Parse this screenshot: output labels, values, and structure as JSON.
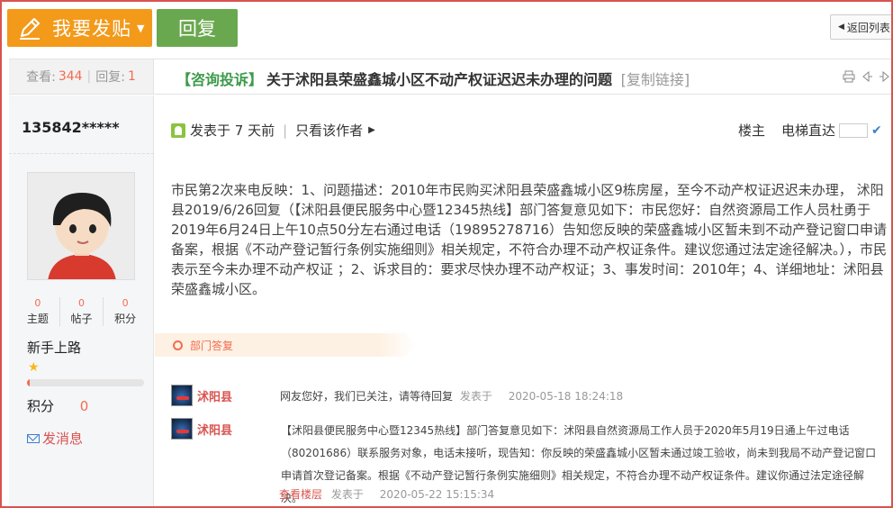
{
  "toolbar": {
    "post_label": "我要发贴",
    "reply_label": "回复",
    "back_label": "返回列表"
  },
  "stats": {
    "views_label": "查看:",
    "views": "344",
    "replies_label": "回复:",
    "replies": "1"
  },
  "thread": {
    "category": "【咨询投诉】",
    "title": "关于沭阳县荣盛鑫城小区不动产权证迟迟未办理的问题",
    "copy_link": "[复制链接]"
  },
  "user": {
    "name": "135842*****",
    "topics": "0",
    "topics_label": "主题",
    "posts": "0",
    "posts_label": "帖子",
    "points": "0",
    "points_label": "积分",
    "rank": "新手上路",
    "rank_progress": 0.02,
    "points_row_label": "积分",
    "points_row_value": "0",
    "message_label": "发消息"
  },
  "post": {
    "posted": "发表于 7 天前",
    "only_author": "只看该作者",
    "floor": "楼主",
    "elevator": "电梯直达",
    "content": "市民第2次来电反映：1、问题描述：2010年市民购买沭阳县荣盛鑫城小区9栋房屋，至今不动产权证迟迟未办理， 沭阳县2019/6/26回复（【沭阳县便民服务中心暨12345热线】部门答复意见如下：市民您好：自然资源局工作人员杜勇于2019年6月24日上午10点50分左右通过电话（19895278716）告知您反映的荣盛鑫城小区暂未到不动产登记窗口申请备案，根据《不动产登记暂行条例实施细则》相关规定，不符合办理不动产权证条件。建议您通过法定途径解决。），市民表示至今未办理不动产权证 ；2、诉求目的：要求尽快办理不动产权证；3、事发时间：2010年；4、详细地址：沭阳县荣盛鑫城小区。"
  },
  "dept": {
    "label": "部门答复",
    "replies": [
      {
        "name": "沭阳县",
        "text": "网友您好，我们已关注，请等待回复",
        "posted_label": "发表于",
        "time": "2020-05-18 18:24:18"
      },
      {
        "name": "沭阳县",
        "text": "【沭阳县便民服务中心暨12345热线】部门答复意见如下：沭阳县自然资源局工作人员于2020年5月19日通上午过电话（80201686）联系服务对象，电话未接听，现告知：你反映的荣盛鑫城小区暂未通过竣工验收，尚未到我局不动产登记窗口申请首次登记备案。根据《不动产登记暂行条例实施细则》相关规定，不符合办理不动产权证条件。建议你通过法定途径解决。",
        "view_label": "查看楼层",
        "posted_label": "发表于",
        "time": "2020-05-22 15:15:34"
      }
    ]
  },
  "colors": {
    "post_button": "#f39a1a",
    "reply_button": "#6aa84f",
    "accent_red": "#f26c4f",
    "category_green": "#3c9a4b"
  }
}
